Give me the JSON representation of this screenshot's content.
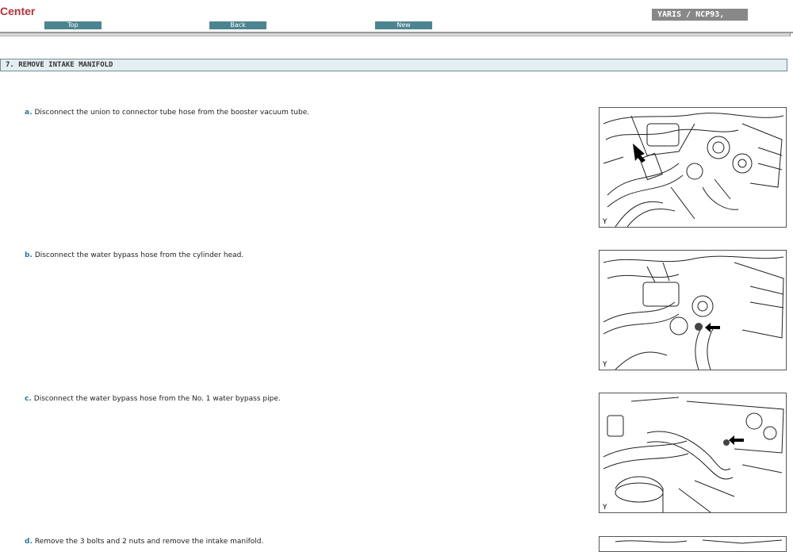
{
  "header": {
    "brand": "Center",
    "nav": {
      "top": "Top",
      "back": "Back",
      "new": "New"
    },
    "model": "YARIS / NCP93,"
  },
  "section": {
    "title": "7. REMOVE INTAKE MANIFOLD"
  },
  "steps": [
    {
      "letter": "a.",
      "text": "Disconnect the union to connector tube hose from the booster vacuum tube.",
      "figure_code": "Y"
    },
    {
      "letter": "b.",
      "text": "Disconnect the water bypass hose from the cylinder head.",
      "figure_code": "Y"
    },
    {
      "letter": "c.",
      "text": "Disconnect the water bypass hose from the No. 1 water bypass pipe.",
      "figure_code": "Y"
    },
    {
      "letter": "d.",
      "text": "Remove the 3 bolts and 2 nuts and remove the intake manifold."
    }
  ]
}
